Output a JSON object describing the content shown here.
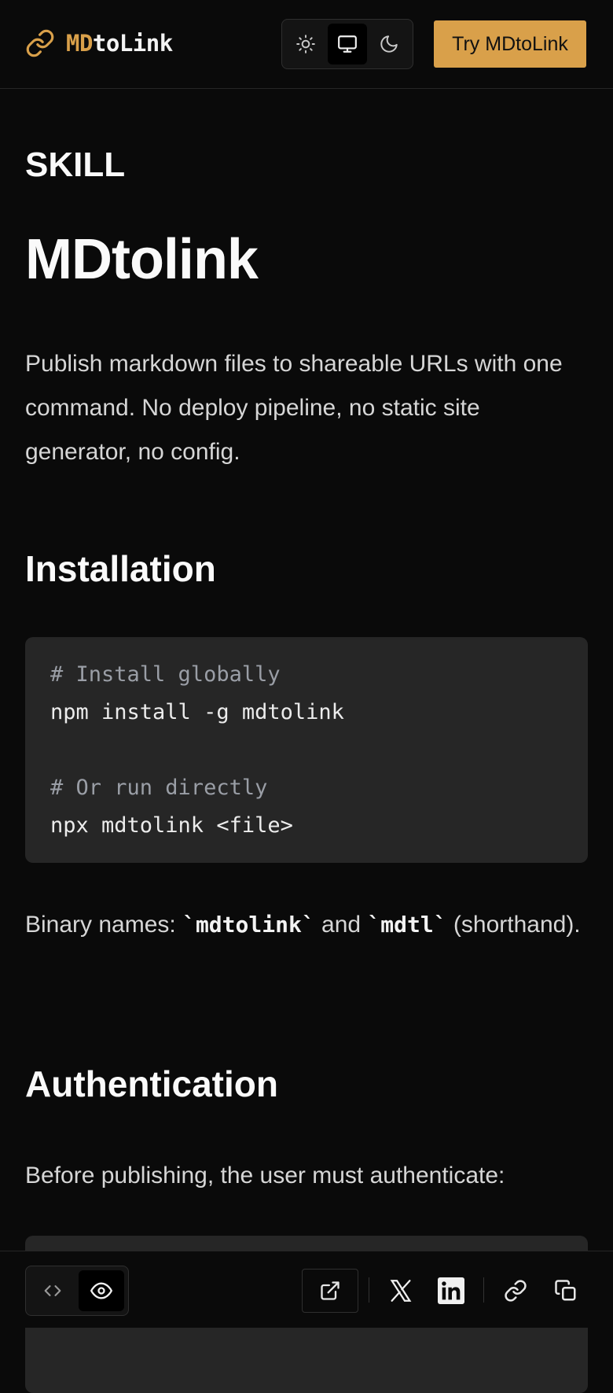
{
  "header": {
    "logo_accent": "MD",
    "logo_rest": "toLink",
    "theme_modes": [
      "light",
      "system",
      "dark"
    ],
    "active_theme": "system",
    "cta_label": "Try MDtoLink"
  },
  "article": {
    "kicker": "SKILL",
    "title": "MDtolink",
    "lead": "Publish markdown files to shareable URLs with one command. No deploy pipeline, no static site generator, no config.",
    "installation": {
      "heading": "Installation",
      "code_lines": [
        {
          "type": "comment",
          "text": "# Install globally"
        },
        {
          "type": "code",
          "text": "npm install -g mdtolink"
        },
        {
          "type": "blank",
          "text": ""
        },
        {
          "type": "comment",
          "text": "# Or run directly"
        },
        {
          "type": "code",
          "text": "npx mdtolink <file>"
        }
      ],
      "binary_prefix": "Binary names: ",
      "binary_1": "`mdtolink`",
      "binary_and": " and ",
      "binary_2": "`mdtl`",
      "binary_suffix": " (shorthand)."
    },
    "authentication": {
      "heading": "Authentication",
      "text": "Before publishing, the user must authenticate:"
    }
  },
  "bottom_bar": {
    "view_modes": [
      "source",
      "preview"
    ],
    "active_view": "preview"
  },
  "colors": {
    "background": "#0a0a0a",
    "accent": "#d9a04a",
    "code_bg": "#262626"
  }
}
